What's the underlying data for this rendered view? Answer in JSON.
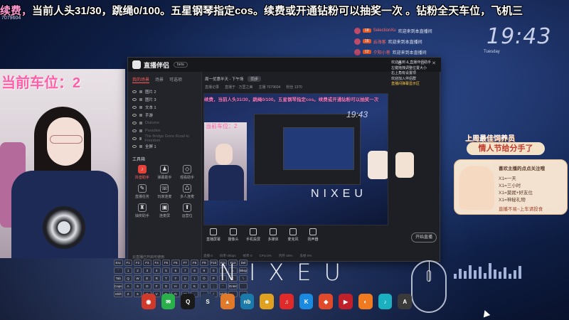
{
  "overlay": {
    "ticker_prefix": "续费，",
    "ticker_main": "当前人头31/30，跳绳0/100。五星钢琴指定cos。续费或开通钻粉可以抽奖一次 。钻粉全天车位，飞机三",
    "small_id": "7079604",
    "clock": "19:43",
    "clock_sub": "Tuesday",
    "car_position": "当前车位：2",
    "brand_big": "NIXEU"
  },
  "chatlog": [
    {
      "level": "18",
      "name": "SelectionXu",
      "message": "欢迎来到本直播间"
    },
    {
      "level": "16",
      "name": "云海客",
      "message": "欢迎来到本直播间"
    },
    {
      "level": "12",
      "name": "夕阳小巷",
      "message": "欢迎来到本直播间"
    }
  ],
  "app": {
    "title": "直播伴侣",
    "version_badge": "beta",
    "side_tabs": [
      "我的场景",
      "场景",
      "可选项"
    ],
    "scenes": [
      {
        "label": "图片 2",
        "dim": false
      },
      {
        "label": "图片 3",
        "dim": false
      },
      {
        "label": "文本 1",
        "dim": false
      },
      {
        "label": "手游",
        "dim": false
      },
      {
        "label": "Dialume",
        "dim": true
      },
      {
        "label": "Paradise",
        "dim": true
      },
      {
        "label": "The Bridge Gone Road to Freedom",
        "dim": true
      },
      {
        "label": "全屏 1",
        "dim": false
      }
    ],
    "tools_title": "工具箱",
    "tools": [
      {
        "label": "抖音助手",
        "hot": true,
        "glyph": "♪"
      },
      {
        "label": "弹幕助手",
        "hot": false,
        "glyph": "♟"
      },
      {
        "label": "观看助手",
        "hot": false,
        "glyph": "◇"
      },
      {
        "label": "直播任务",
        "hot": false,
        "glyph": "✎"
      },
      {
        "label": "玩家连麦",
        "hot": false,
        "glyph": "☏"
      },
      {
        "label": "多人连麦",
        "hot": false,
        "glyph": "♺"
      },
      {
        "label": "抽奖助手",
        "hot": false,
        "glyph": "♜"
      },
      {
        "label": "连麦屏",
        "hot": false,
        "glyph": "▣"
      },
      {
        "label": "运营位",
        "hot": false,
        "glyph": "⬆"
      }
    ],
    "side_footer": "云直播已开启可使用",
    "top_bar": {
      "title": "周一优惠半天 - 下午场",
      "pill": "同步"
    },
    "stats": [
      "直播记录",
      "直播于 · 万里之美",
      "主播 7079604",
      "粉丝 1370"
    ],
    "preview": {
      "ticker": "续费，当前人头31/30，跳绳0/100。五星钢琴指定cos。续费或开通钻粉可以抽奖一次",
      "car_label": "当前车位：2",
      "clock": "19:43",
      "nixeu": "NIXEU"
    },
    "chat_panel": {
      "line1": "欢迎来到 & 直播伴侣助手",
      "line2": "左键拖拽调整位置大小",
      "line3": "右上角有设置项",
      "line4": "欢迎加入伴侣群",
      "highlight": "直播间弹幕显示区"
    },
    "bottom_buttons": [
      "直播屏幕",
      "摄像头",
      "手机投屏",
      "多媒体",
      "麦克风",
      "扬声器"
    ],
    "start_button": "开始直播",
    "status_items": [
      "直播·0",
      "码率·0kbps",
      "帧率·0",
      "CPU:4%",
      "内存·45%",
      "丢帧·0%"
    ]
  },
  "keyboard_keys": [
    "Esc",
    "F1",
    "F2",
    "F3",
    "F4",
    "F5",
    "F6",
    "F7",
    "F8",
    "F9",
    "F10",
    "F11",
    "F12",
    "Del",
    "`",
    "1",
    "2",
    "3",
    "4",
    "5",
    "6",
    "7",
    "8",
    "9",
    "0",
    "-",
    "=",
    "Bksp",
    "Tab",
    "Q",
    "W",
    "E",
    "R",
    "T",
    "Y",
    "U",
    "I",
    "O",
    "P",
    "[",
    "]",
    "\\",
    "Caps",
    "A",
    "S",
    "D",
    "F",
    "G",
    "H",
    "J",
    "K",
    "L",
    ";",
    "'",
    "Enter",
    "",
    "Shift",
    "Z",
    "X",
    "C",
    "V",
    "B",
    "N",
    "M",
    ",",
    ".",
    "/",
    "Shift",
    "",
    ""
  ],
  "taskbar": [
    {
      "name": "app-browser-icon",
      "color": "#d03a2a",
      "glyph": "◉"
    },
    {
      "name": "wechat-icon",
      "color": "#2ab04a",
      "glyph": "✉"
    },
    {
      "name": "qq-icon",
      "color": "#1a1a1a",
      "glyph": "Q"
    },
    {
      "name": "steam-icon",
      "color": "#2a3a5a",
      "glyph": "S"
    },
    {
      "name": "game-icon",
      "color": "#e07a2a",
      "glyph": "▲"
    },
    {
      "name": "nb-icon",
      "color": "#1a7aaa",
      "glyph": "nb"
    },
    {
      "name": "pet-icon",
      "color": "#e0a020",
      "glyph": "☻"
    },
    {
      "name": "netease-music-icon",
      "color": "#e02a2a",
      "glyph": "♫"
    },
    {
      "name": "kugou-icon",
      "color": "#1a8ae0",
      "glyph": "K"
    },
    {
      "name": "bird-icon",
      "color": "#e04a2a",
      "glyph": "◆"
    },
    {
      "name": "video-icon",
      "color": "#c0202a",
      "glyph": "▶"
    },
    {
      "name": "live-icon",
      "color": "#f07a20",
      "glyph": "◐"
    },
    {
      "name": "douyin-icon",
      "color": "#1ab0c0",
      "glyph": "♪"
    },
    {
      "name": "ae-icon",
      "color": "#3a3a3a",
      "glyph": "A"
    }
  ],
  "promo": {
    "title": "上周最佳饲养员",
    "banner": "情人节给分手了",
    "line1": "喜欢主播的点点关注哦",
    "line2": "X1=一天",
    "line3": "X1=三小时",
    "line4": "X1=莫妮+好友位",
    "line5": "X1=神秘礼物",
    "line6": "直播不易~上车请投食"
  },
  "visualizer_levels": [
    0.3,
    0.6,
    0.45,
    0.8,
    0.5,
    0.7,
    0.35,
    0.9,
    0.55,
    0.4,
    0.65,
    0.3,
    0.5,
    0.75
  ]
}
